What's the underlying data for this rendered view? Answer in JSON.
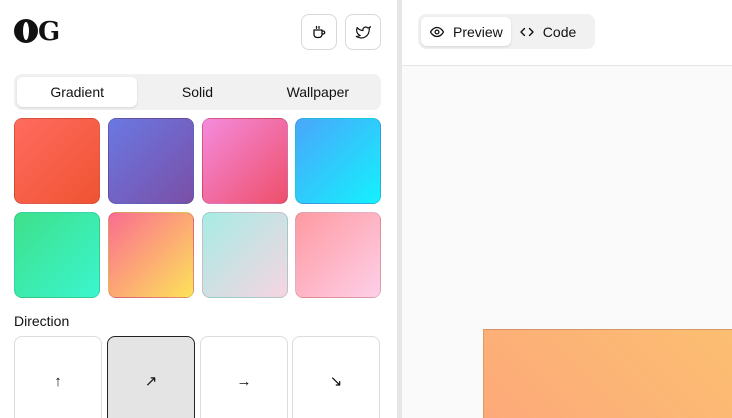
{
  "header": {
    "logo_text": "OG",
    "buttons": [
      {
        "name": "coffee",
        "icon": "coffee-cup-icon"
      },
      {
        "name": "twitter",
        "icon": "twitter-icon"
      }
    ]
  },
  "tabs": [
    {
      "label": "Gradient",
      "active": true
    },
    {
      "label": "Solid",
      "active": false
    },
    {
      "label": "Wallpaper",
      "active": false
    }
  ],
  "gradients": [
    {
      "from": "#ff6b5f",
      "to": "#ef5331"
    },
    {
      "from": "#6a78e3",
      "to": "#7a4fa6"
    },
    {
      "from": "#f48bdd",
      "to": "#ee4f6a"
    },
    {
      "from": "#4aa6fb",
      "to": "#14f1fd"
    },
    {
      "from": "#3ee08a",
      "to": "#3bf6cf"
    },
    {
      "from": "#fa6d90",
      "to": "#fde25a"
    },
    {
      "from": "#a7ece5",
      "to": "#f6d4e1"
    },
    {
      "from": "#ff9aa1",
      "to": "#fdcfe8"
    }
  ],
  "direction": {
    "label": "Direction",
    "options": [
      {
        "name": "up",
        "glyph": "↑",
        "selected": false
      },
      {
        "name": "up-right",
        "glyph": "↗",
        "selected": true
      },
      {
        "name": "right",
        "glyph": "→",
        "selected": false
      },
      {
        "name": "down-right",
        "glyph": "↘",
        "selected": false
      }
    ]
  },
  "viewer": {
    "modes": [
      {
        "label": "Preview",
        "icon": "eye-icon",
        "active": true
      },
      {
        "label": "Code",
        "icon": "code-icon",
        "active": false
      }
    ],
    "preview": {
      "from": "#fda97a",
      "to": "#fcbf71"
    }
  }
}
